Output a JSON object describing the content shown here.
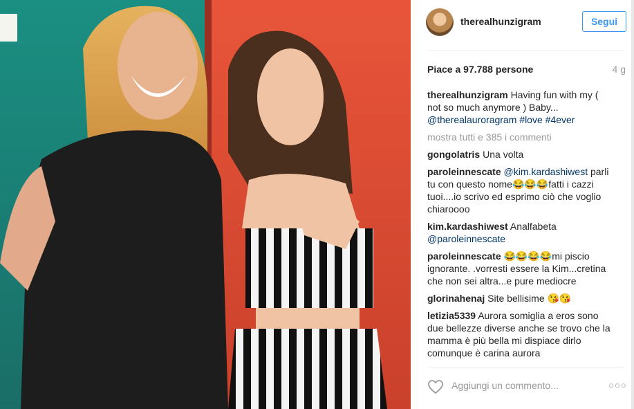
{
  "post": {
    "username": "therealhunzigram",
    "follow_label": "Segui",
    "likes_text": "Piace a 97.788 persone",
    "time_ago": "4 g"
  },
  "caption": {
    "user": "therealhunzigram",
    "text": "Having fun with my ( not so much anymore ) Baby...",
    "mention": "@therealauroragram",
    "tag1": "#love",
    "tag2": "#4ever"
  },
  "show_all": "mostra tutti e 385 i commenti",
  "comments": [
    {
      "user": "gongolatris",
      "text": "Una volta"
    },
    {
      "user": "paroleinnescate",
      "mention": "@kim.kardashiwest",
      "text": "parli tu con questo nome😂😂😂fatti i cazzi tuoi....io scrivo ed esprimo ciò che voglio chiaroooo"
    },
    {
      "user": "kim.kardashiwest",
      "text": "Analfabeta",
      "mention": "@paroleinnescate"
    },
    {
      "user": "paroleinnescate",
      "text": "😂😂😂😂mi piscio ignorante. .vorresti essere la Kim...cretina che non sei altra...e pure mediocre"
    },
    {
      "user": "glorinahenaj",
      "text": "Site bellisime 😘😘"
    },
    {
      "user": "letizia5339",
      "text": "Aurora somiglia a eros sono due bellezze diverse anche se trovo che la mamma è più bella mi dispiace dirlo comunque è carina aurora"
    }
  ],
  "footer": {
    "add_comment_placeholder": "Aggiungi un commento...",
    "more_options": "○○○"
  },
  "colors": {
    "accent": "#3897f0",
    "link": "#003569",
    "muted": "#999999"
  },
  "icons": {
    "like": "heart-icon",
    "more": "more-options-icon"
  }
}
